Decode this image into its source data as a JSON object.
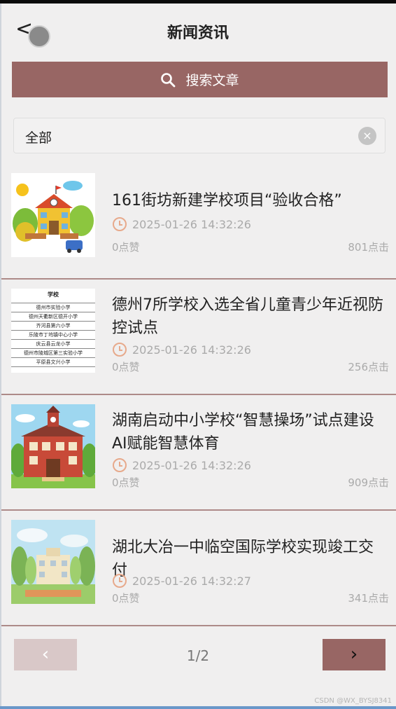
{
  "header": {
    "title": "新闻资讯",
    "back_label": "<"
  },
  "search": {
    "label": "搜索文章"
  },
  "filter": {
    "value": "全部",
    "clear_label": "×"
  },
  "articles": [
    {
      "title": "161街坊新建学校项目“验收合格”",
      "time": "2025-01-26 14:32:26",
      "likes": "0点赞",
      "clicks": "801点击",
      "thumb": "school-cartoon"
    },
    {
      "title": "德州7所学校入选全省儿童青少年近视防控试点",
      "time": "2025-01-26 14:32:26",
      "likes": "0点赞",
      "clicks": "256点击",
      "thumb": "school-list-table",
      "thumb_text": {
        "heading": "学校",
        "rows": [
          "德州市实验小学",
          "德州天衢新区德开小学",
          "齐河县第六小学",
          "乐陵市丁坞镇中心小学",
          "庆云县云龙小学",
          "德州市陵城区第三实验小学",
          "平原县文兴小学"
        ]
      }
    },
    {
      "title": "湖南启动中小学校“智慧操场”试点建设 AI赋能智慧体育",
      "time": "2025-01-26 14:32:26",
      "likes": "0点赞",
      "clicks": "909点击",
      "thumb": "red-school-building"
    },
    {
      "title": "湖北大冶一中临空国际学校实现竣工交付",
      "time": "2025-01-26 14:32:27",
      "likes": "0点赞",
      "clicks": "341点击",
      "thumb": "school-campus-painting"
    }
  ],
  "pager": {
    "text": "1/2",
    "prev_label": "‹",
    "next_label": "›"
  },
  "watermark": "CSDN @WX_BYSJ8341",
  "colors": {
    "accent": "#986664",
    "divider": "#ad8a88",
    "clock": "#e7a98b"
  }
}
